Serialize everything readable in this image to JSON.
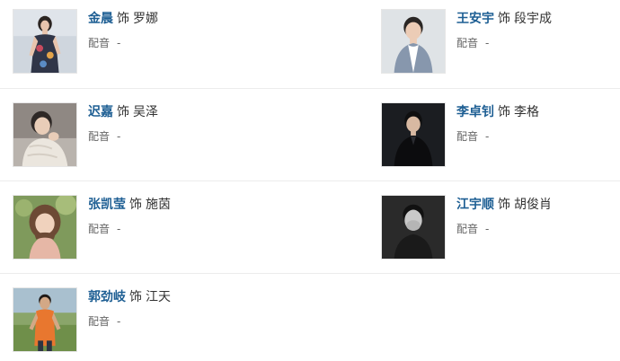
{
  "cast": [
    {
      "actor": "金晨",
      "role_word": "饰",
      "role": "罗娜",
      "dub_label": "配音",
      "dub_value": "-",
      "photo_icon": "actress-portrait-dress"
    },
    {
      "actor": "王安宇",
      "role_word": "饰",
      "role": "段宇成",
      "dub_label": "配音",
      "dub_value": "-",
      "photo_icon": "actor-portrait-grey-jacket"
    },
    {
      "actor": "迟嘉",
      "role_word": "饰",
      "role": "吴泽",
      "dub_label": "配音",
      "dub_value": "-",
      "photo_icon": "actor-portrait-white-sweater"
    },
    {
      "actor": "李卓钊",
      "role_word": "饰",
      "role": "李格",
      "dub_label": "配音",
      "dub_value": "-",
      "photo_icon": "actor-portrait-dark-suit"
    },
    {
      "actor": "张凯莹",
      "role_word": "饰",
      "role": "施茵",
      "dub_label": "配音",
      "dub_value": "-",
      "photo_icon": "actress-portrait-outdoor"
    },
    {
      "actor": "江宇顺",
      "role_word": "饰",
      "role": "胡俊肖",
      "dub_label": "配音",
      "dub_value": "-",
      "photo_icon": "actor-portrait-bw"
    },
    {
      "actor": "郭劲岐",
      "role_word": "饰",
      "role": "江天",
      "dub_label": "配音",
      "dub_value": "-",
      "photo_icon": "actor-portrait-orange-jersey"
    }
  ],
  "colors": {
    "actor_link": "#1d5e93",
    "text": "#333333",
    "muted": "#666666",
    "divider": "#ececec"
  }
}
